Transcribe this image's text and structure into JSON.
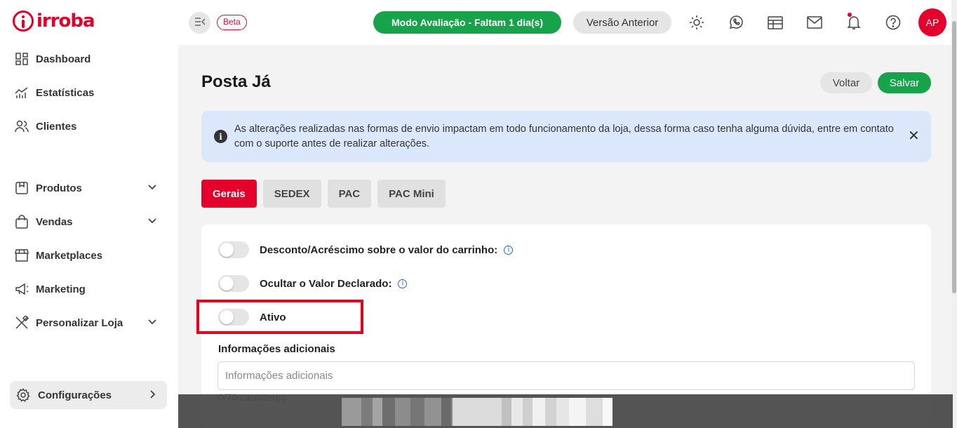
{
  "brand": {
    "name": "irroba"
  },
  "sidebar": {
    "items": [
      {
        "label": "Dashboard",
        "icon": "dashboard-icon"
      },
      {
        "label": "Estatísticas",
        "icon": "chart-icon"
      },
      {
        "label": "Clientes",
        "icon": "users-icon"
      },
      {
        "label": "Produtos",
        "icon": "box-icon",
        "expandable": true
      },
      {
        "label": "Vendas",
        "icon": "bag-icon",
        "expandable": true
      },
      {
        "label": "Marketplaces",
        "icon": "store-icon"
      },
      {
        "label": "Marketing",
        "icon": "megaphone-icon"
      },
      {
        "label": "Personalizar Loja",
        "icon": "brush-icon",
        "expandable": true
      }
    ],
    "config": {
      "label": "Configurações",
      "icon": "gear-icon"
    }
  },
  "topbar": {
    "beta_label": "Beta",
    "eval_label": "Modo Avaliação - Faltam 1 dia(s)",
    "prev_version_label": "Versão Anterior",
    "avatar_initials": "AP"
  },
  "page": {
    "title": "Posta Já",
    "back_label": "Voltar",
    "save_label": "Salvar"
  },
  "alert": {
    "message": "As alterações realizadas nas formas de envio impactam em todo funcionamento da loja, dessa forma caso tenha alguma dúvida, entre em contato com o suporte antes de realizar alterações."
  },
  "tabs": [
    {
      "label": "Gerais",
      "active": true
    },
    {
      "label": "SEDEX",
      "active": false
    },
    {
      "label": "PAC",
      "active": false
    },
    {
      "label": "PAC Mini",
      "active": false
    }
  ],
  "form": {
    "toggles": [
      {
        "label": "Desconto/Acréscimo sobre o valor do carrinho:",
        "on": false,
        "info": true
      },
      {
        "label": "Ocultar o Valor Declarado:",
        "on": false,
        "info": true
      },
      {
        "label": "Ativo",
        "on": false,
        "info": false
      }
    ],
    "additional_info": {
      "label": "Informações adicionais",
      "placeholder": "Informações adicionais",
      "value": "",
      "counter": "0/70 caracteres"
    }
  },
  "colors": {
    "brand_red": "#e4002b",
    "success_green": "#16a34a",
    "alert_blue": "#dbe8fb",
    "highlight_red": "#e4001a"
  }
}
